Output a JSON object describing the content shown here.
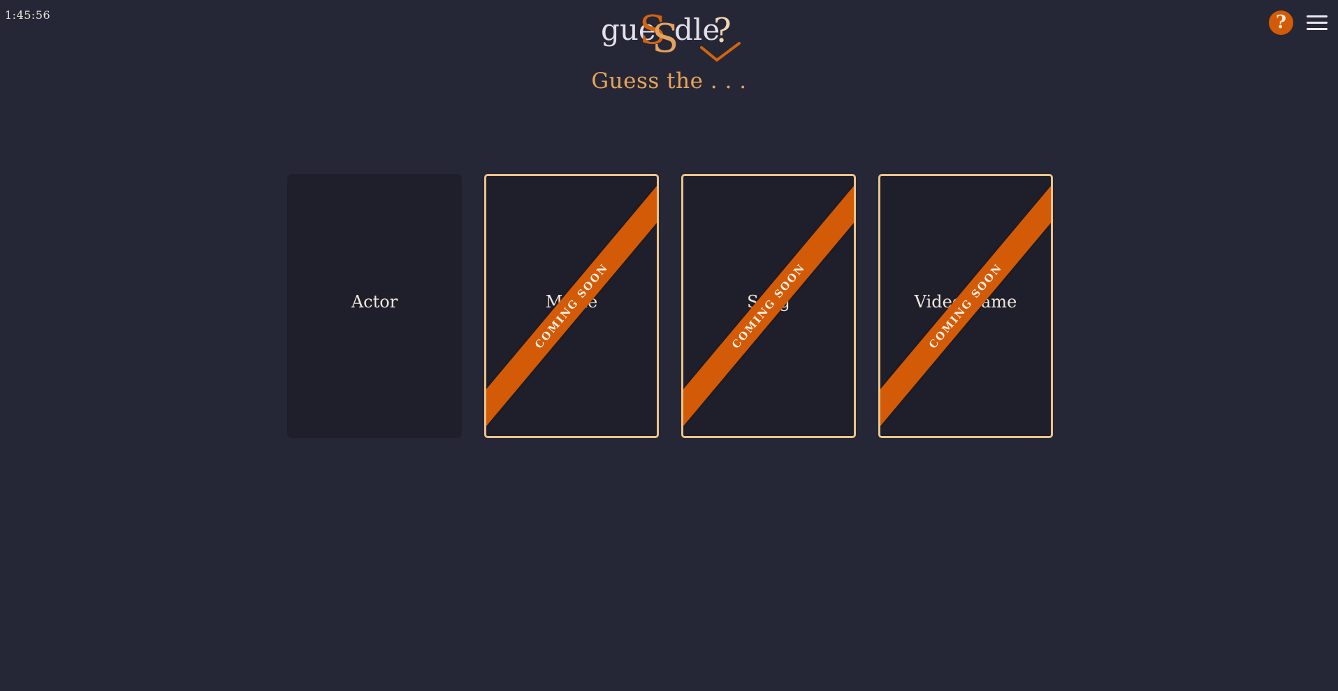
{
  "timer": "1:45:56",
  "logo": {
    "part1": "gue",
    "s1": "S",
    "s2": "S",
    "part2": "dle",
    "q": "?"
  },
  "subtitle": "Guess the . . .",
  "header": {
    "help_label": "?"
  },
  "cards": [
    {
      "label": "Actor",
      "ribbon": ""
    },
    {
      "label": "Movie",
      "ribbon": "COMING SOON"
    },
    {
      "label": "Song",
      "ribbon": "COMING SOON"
    },
    {
      "label": "Video Game",
      "ribbon": "COMING SOON"
    }
  ],
  "colors": {
    "background": "#262736",
    "card": "#1f1f2b",
    "accent": "#d35a06",
    "border": "#e9c48b",
    "subtitle": "#e9a35a"
  }
}
